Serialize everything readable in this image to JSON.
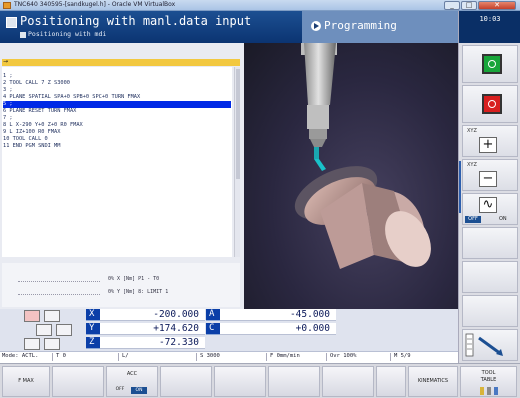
{
  "window": {
    "title": "TNC640 340595-[sandkugel.h] - Oracle VM VirtualBox",
    "minimize_glyph": "_",
    "maximize_glyph": "□",
    "close_glyph": "✕"
  },
  "header": {
    "title": "Positioning with manl.data input",
    "subtitle": "Positioning with mdi",
    "mode_icon": "programming-play-icon",
    "mode_label": "Programming",
    "clock": "10:03"
  },
  "program": {
    "header_glyph": "→",
    "lines": [
      {
        "no": "1",
        "text": " ;",
        "selected": false
      },
      {
        "no": "2",
        "text": " TOOL CALL 7 Z S3000",
        "selected": false
      },
      {
        "no": "3",
        "text": " ;",
        "selected": false
      },
      {
        "no": "4",
        "text": " PLANE SPATIAL SPA+0 SPB+0 SPC+0 TURN FMAX",
        "selected": false
      },
      {
        "no": "5",
        "text": " ;",
        "selected": true
      },
      {
        "no": "6",
        "text": " PLANE RESET TURN FMAX",
        "selected": false
      },
      {
        "no": "7",
        "text": " ;",
        "selected": false
      },
      {
        "no": "8",
        "text": " L  X-290  Y+0  Z+0 R0 FMAX",
        "selected": false
      },
      {
        "no": "9",
        "text": " L IZ+100 R0 FMAX",
        "selected": false
      },
      {
        "no": "10",
        "text": " TOOL CALL 0",
        "selected": false
      },
      {
        "no": "11",
        "text": " END PGM SNDI MM",
        "selected": false
      }
    ],
    "status_lines": [
      {
        "text": "0% X [Nm]  P1 - T0"
      },
      {
        "text": "0% Y [Nm]  8: LIMIT 1",
        "limit": "LIMIT 1"
      }
    ]
  },
  "positions": [
    {
      "axis": "X",
      "value": "-200.000"
    },
    {
      "axis": "Y",
      "value": "+174.620"
    },
    {
      "axis": "Z",
      "value": "-72.330"
    },
    {
      "axis": "A",
      "value": "-45.000"
    },
    {
      "axis": "C",
      "value": "+0.000"
    }
  ],
  "modebar": {
    "mode": "Mode: ACTL.",
    "tool": "T 0",
    "plane": "L/",
    "spindle": "S 3000",
    "feed": "F 0mm/min",
    "override": "Ovr 100%",
    "mfunc": "M 5/9"
  },
  "right_softkeys": {
    "xyz_plus_caption": "XYZ",
    "plus_glyph": "+",
    "xyz_minus_caption": "XYZ",
    "minus_glyph": "−",
    "wave_glyph": "∿",
    "toggle_off": "OFF",
    "toggle_on": "ON"
  },
  "softkeys": {
    "f_max": "F MAX",
    "acc": "ACC",
    "acc_off": "OFF",
    "acc_on": "ON",
    "kinematics": "KINEMATICS",
    "tool_table_1": "TOOL",
    "tool_table_2": "TABLE"
  },
  "colors": {
    "header_blue": "#0a2f66",
    "selection_blue": "#0029e6",
    "axis_blue": "#0b3fa8",
    "program_header_yellow": "#f2c840",
    "cycle_start_green": "#18a53a",
    "cycle_stop_red": "#d81f1f"
  }
}
